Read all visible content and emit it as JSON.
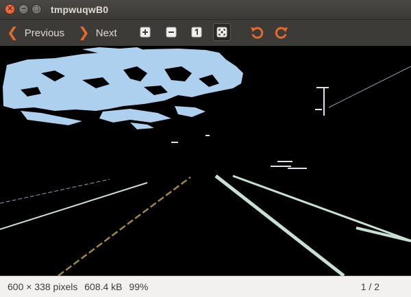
{
  "window": {
    "title": "tmpwuqwB0",
    "close_glyph": "✕",
    "minimize_glyph": "−",
    "maximize_glyph": "□"
  },
  "toolbar": {
    "previous_label": "Previous",
    "next_label": "Next",
    "previous_icon": "chevron-left-icon",
    "next_icon": "chevron-right-icon",
    "tools": [
      "zoom-in-icon",
      "zoom-out-icon",
      "original-size-icon",
      "best-fit-icon",
      "rotate-left-icon",
      "rotate-right-icon"
    ],
    "accent_color": "#e66a2c"
  },
  "status": {
    "dimensions": "600 × 338 pixels",
    "file_size": "608.4 kB",
    "zoom": "99%",
    "position": "1 / 2"
  },
  "image": {
    "description_colors": {
      "sky": "#aed0ef",
      "lane_markings": "#c8e0d4",
      "yellow_line": "#a08a3a"
    }
  }
}
